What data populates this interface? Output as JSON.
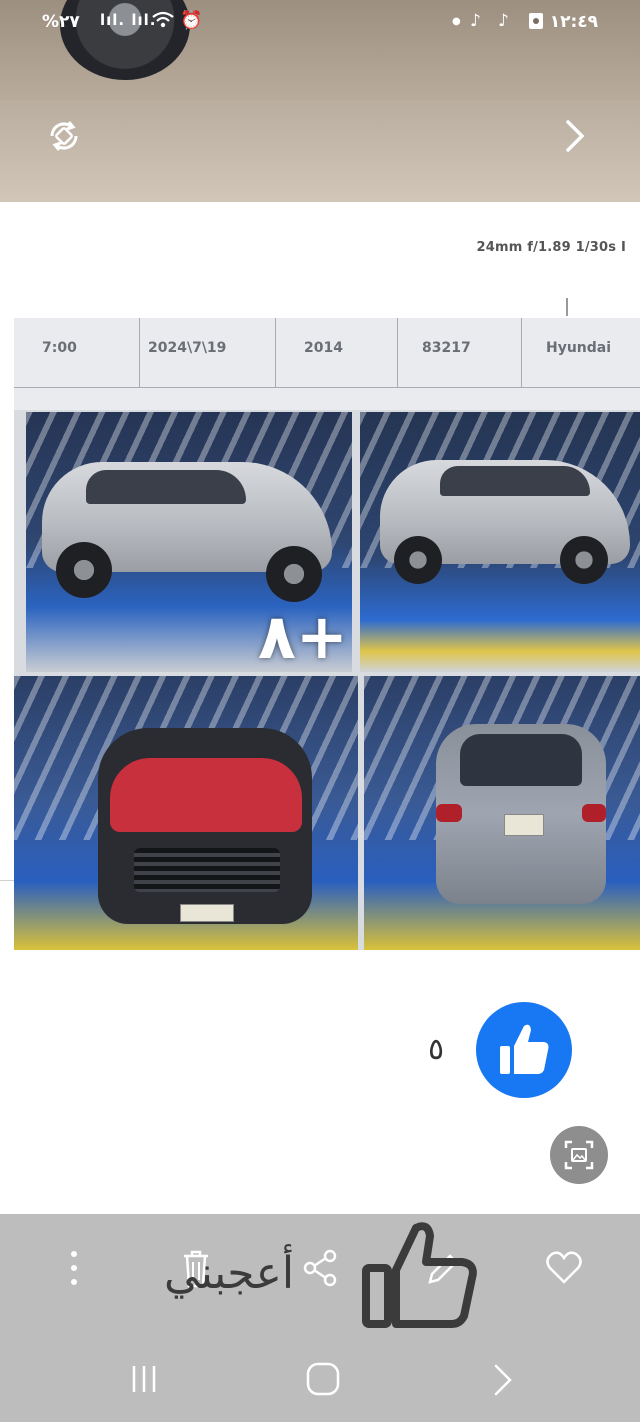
{
  "status_bar": {
    "time": "١٢:٤٩",
    "battery": "%٢٧",
    "signal": "lıl. lıl.",
    "app_icons": [
      "tiktok-icon",
      "tiktok-icon",
      "gallery-icon"
    ]
  },
  "photo_controls": {
    "rotate_icon": "rotate-icon",
    "next_icon": "chevron-right-icon"
  },
  "photo_info": {
    "exif": "24mm f/1.89 1/30s I"
  },
  "document_header": {
    "cells": [
      "7:00",
      "2024\\7\\19",
      "2014",
      "83217",
      "Hyundai"
    ]
  },
  "main_photo": {
    "more_count_label": "٨+"
  },
  "reactions": {
    "like_icon": "thumbs-up-icon",
    "like_count": "٥",
    "brand_color": "#1877f2"
  },
  "toolbar": {
    "items": [
      "more-options-icon",
      "delete-icon",
      "share-icon",
      "edit-icon",
      "favorite-icon"
    ],
    "overlay_label": "أعجبني"
  },
  "nav_bar": {
    "items": [
      "recents-icon",
      "home-icon",
      "back-icon"
    ]
  }
}
